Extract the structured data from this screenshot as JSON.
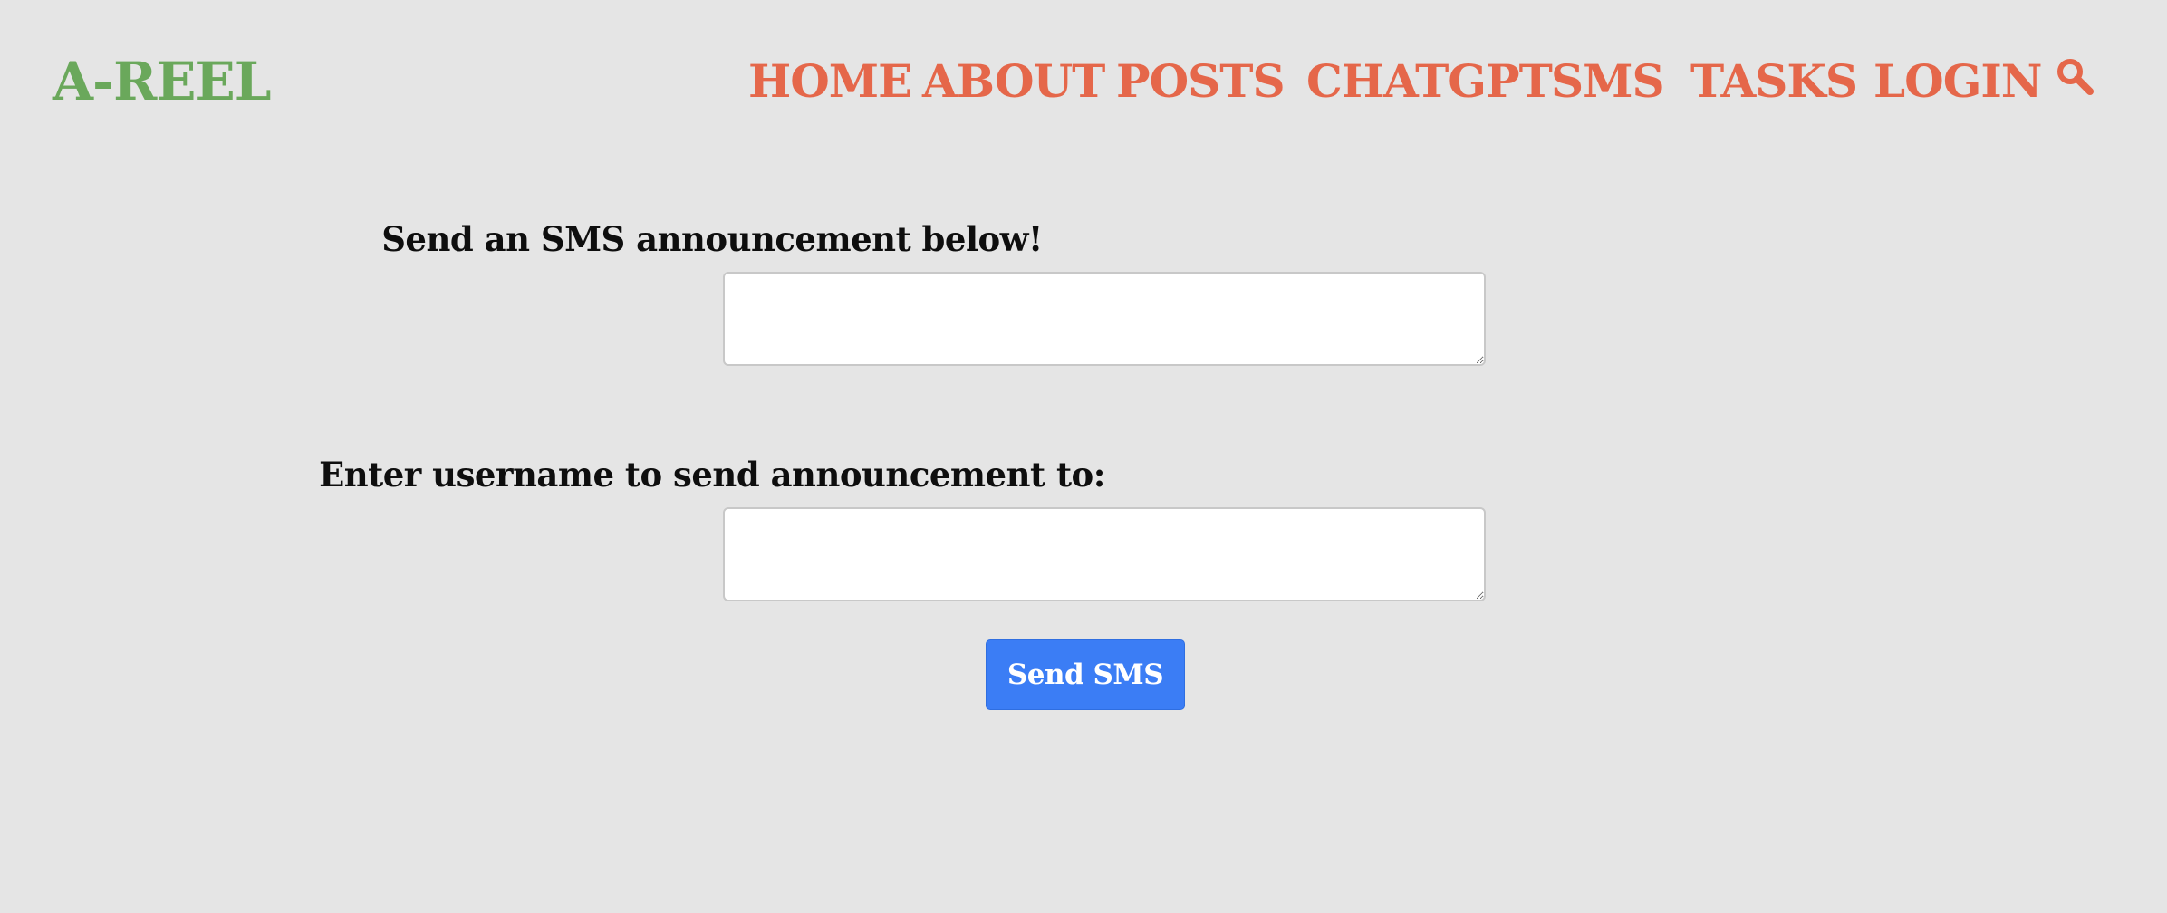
{
  "header": {
    "logo": "A-REEL",
    "nav": [
      {
        "label": "HOME"
      },
      {
        "label": "ABOUT"
      },
      {
        "label": "POSTS"
      },
      {
        "label": "CHATGPT"
      },
      {
        "label": "SMS"
      },
      {
        "label": "TASKS"
      },
      {
        "label": "LOGIN"
      }
    ],
    "search_icon": "search-icon"
  },
  "form": {
    "message_label": "Send an SMS announcement below!",
    "message_value": "",
    "username_label": "Enter username to send announcement to:",
    "username_value": "",
    "submit_label": "Send SMS"
  },
  "colors": {
    "background": "#e5e5e5",
    "logo": "#6aa85b",
    "nav": "#e5674a",
    "button": "#3b7df5",
    "label": "#0e0e0e"
  }
}
